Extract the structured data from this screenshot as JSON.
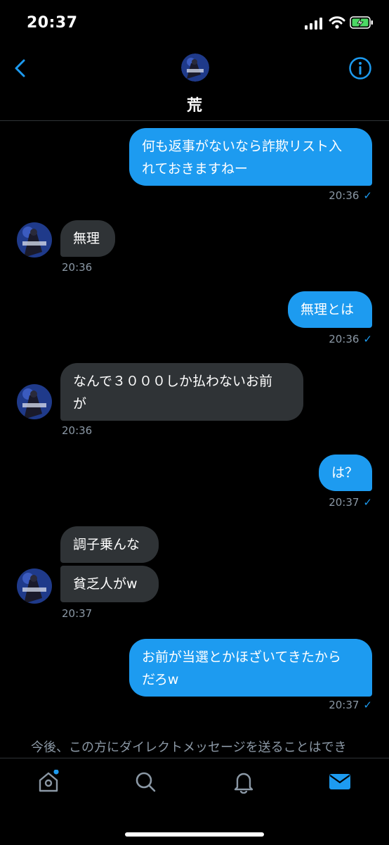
{
  "status": {
    "time": "20:37"
  },
  "header": {
    "name": "荒"
  },
  "messages": [
    {
      "side": "sent",
      "text": "何も返事がないなら詐欺リスト入\nれておきますねー",
      "time": "20:36"
    },
    {
      "side": "recv",
      "text": "無理",
      "time": "20:36"
    },
    {
      "side": "sent",
      "text": "無理とは",
      "time": "20:36"
    },
    {
      "side": "recv",
      "text": "なんで３０００しか払わないお前\nが",
      "time": "20:36"
    },
    {
      "side": "sent",
      "text": "は？",
      "time": "20:37"
    },
    {
      "side": "recv",
      "text": "調子乗んな",
      "time": ""
    },
    {
      "side": "recv",
      "text": "貧乏人がw",
      "time": "20:37"
    },
    {
      "side": "sent",
      "text": "お前が当選とかほざいてきたから\nだろw",
      "time": "20:37"
    }
  ],
  "read_mark": "✓",
  "notice": "今後、この方にダイレクトメッセージを送ることはでき",
  "tabs": {
    "home": "home-icon",
    "search": "search-icon",
    "notifications": "bell-icon",
    "messages": "mail-icon"
  },
  "colors": {
    "accent": "#1d9bf0",
    "received_bubble": "#2f3336",
    "meta": "#8b98a5"
  }
}
